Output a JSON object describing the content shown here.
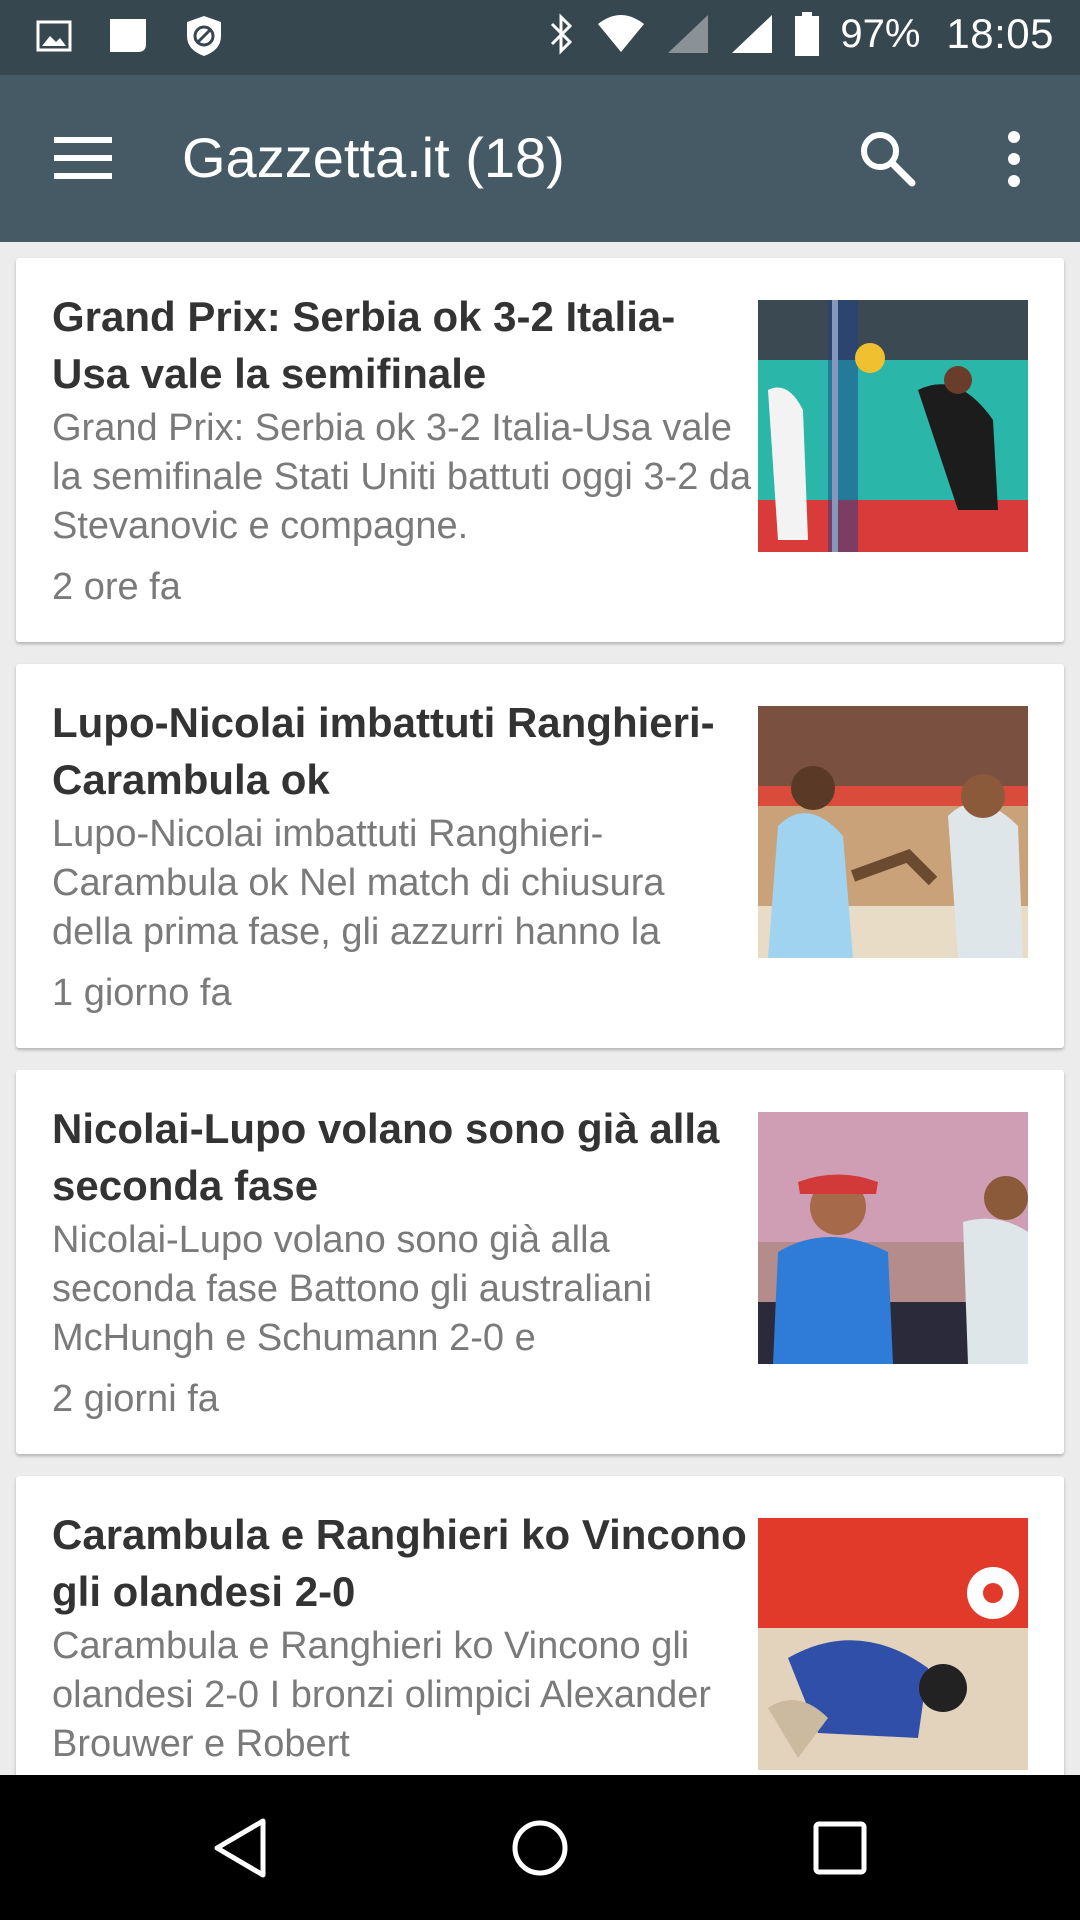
{
  "status_bar": {
    "battery_percent": "97%",
    "time": "18:05",
    "icons": [
      "image-icon",
      "chat-icon",
      "shield-icon",
      "bluetooth-icon",
      "wifi-icon",
      "signal-icon",
      "signal-icon",
      "battery-icon"
    ]
  },
  "app_bar": {
    "title": "Gazzetta.it (18)",
    "background_color": "#455a64"
  },
  "articles": [
    {
      "title": "Grand Prix: Serbia ok 3-2 Italia-Usa vale la  semifinale",
      "summary": "Grand Prix: Serbia ok 3-2 Italia-Usa vale la semifinale Stati Uniti battuti oggi 3-2 da Stevanovic e compagne.",
      "time": "2 ore fa"
    },
    {
      "title": "Lupo-Nicolai imbattuti Ranghieri-Carambula ok",
      "summary": "Lupo-Nicolai imbattuti Ranghieri-Carambula ok Nel match di chiusura della prima fase, gli azzurri hanno la",
      "time": "1 giorno fa"
    },
    {
      "title": "Nicolai-Lupo volano  sono già alla seconda fase",
      "summary": "Nicolai-Lupo volano sono già alla seconda fase Battono gli australiani McHungh e Schumann 2-0 e",
      "time": "2 giorni fa"
    },
    {
      "title": "Carambula e Ranghieri ko Vincono gli olandesi 2-0",
      "summary": "Carambula e Ranghieri ko Vincono gli olandesi 2-0 I bronzi olimpici Alexander Brouwer e Robert",
      "time": ""
    }
  ]
}
